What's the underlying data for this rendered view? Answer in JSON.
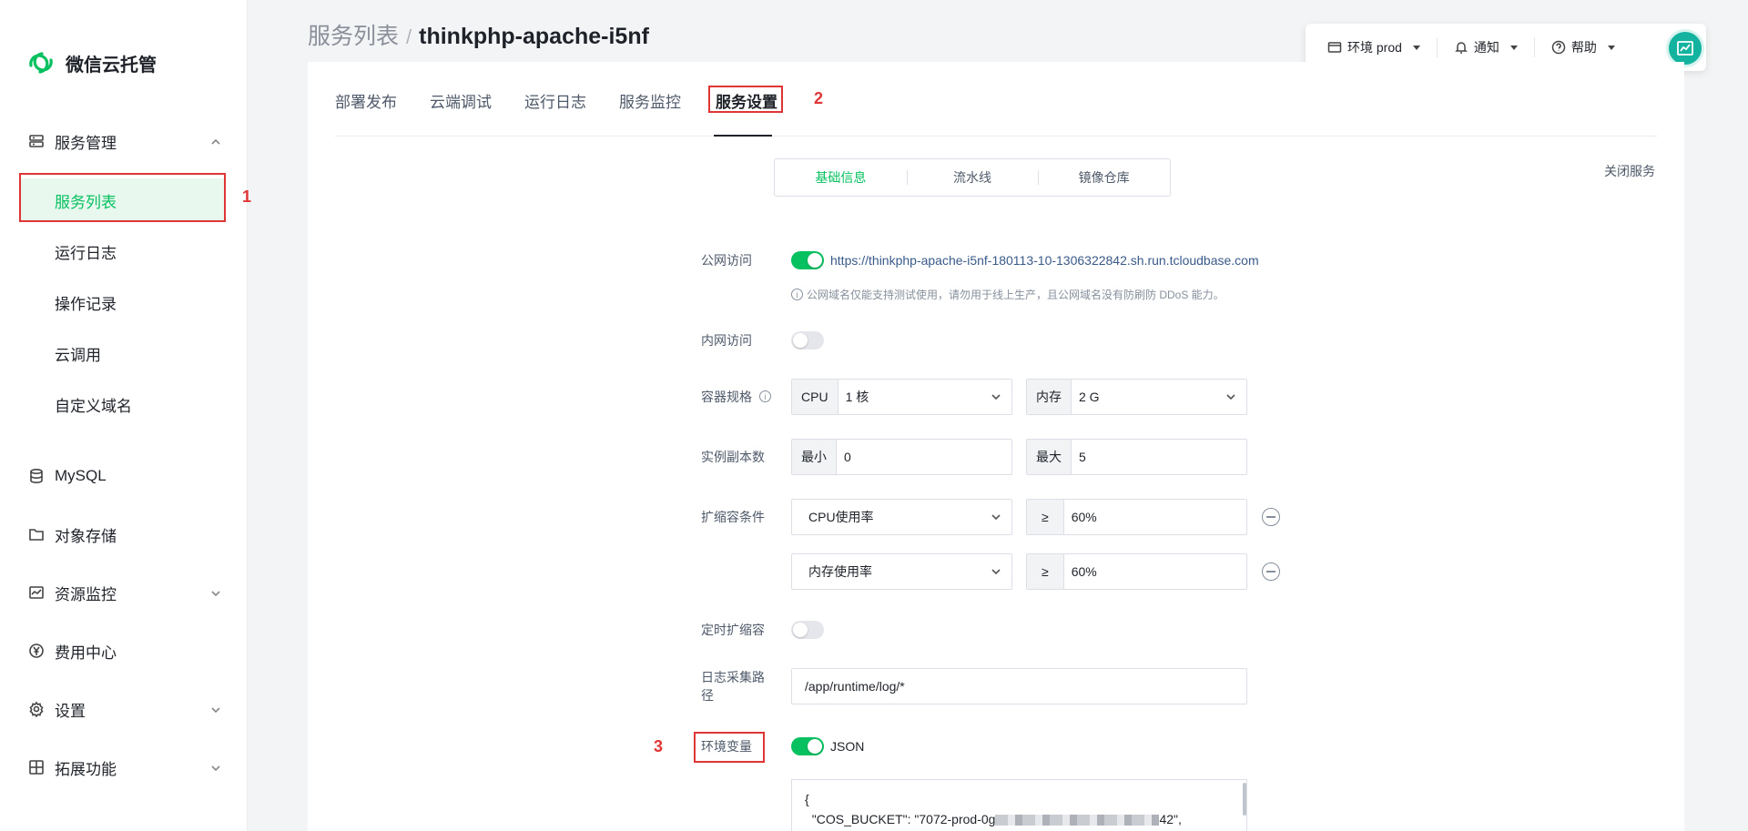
{
  "app": {
    "name": "微信云托管"
  },
  "sidebar": {
    "groups": [
      {
        "label": "服务管理",
        "icon": "server-icon",
        "expanded": true
      },
      {
        "label": "MySQL",
        "icon": "database-icon"
      },
      {
        "label": "对象存储",
        "icon": "folder-icon"
      },
      {
        "label": "资源监控",
        "icon": "monitor-icon",
        "expanded": false
      },
      {
        "label": "费用中心",
        "icon": "yen-icon"
      },
      {
        "label": "设置",
        "icon": "gear-icon",
        "expanded": false
      },
      {
        "label": "拓展功能",
        "icon": "extension-icon",
        "expanded": false
      }
    ],
    "items": [
      {
        "label": "服务列表",
        "active": true
      },
      {
        "label": "运行日志"
      },
      {
        "label": "操作记录"
      },
      {
        "label": "云调用"
      },
      {
        "label": "自定义域名"
      }
    ]
  },
  "annotations": {
    "n1": "1",
    "n2": "2",
    "n3": "3",
    "color": "#e03535"
  },
  "breadcrumb": {
    "parent": "服务列表",
    "separator": "/",
    "current": "thinkphp-apache-i5nf"
  },
  "topbar": {
    "env": "环境 prod",
    "notify": "通知",
    "help": "帮助"
  },
  "tabs": [
    {
      "label": "部署发布"
    },
    {
      "label": "云端调试"
    },
    {
      "label": "运行日志"
    },
    {
      "label": "服务监控"
    },
    {
      "label": "服务设置",
      "active": true
    }
  ],
  "segments": [
    {
      "label": "基础信息",
      "active": true
    },
    {
      "label": "流水线"
    },
    {
      "label": "镜像仓库"
    }
  ],
  "close_service": "关闭服务",
  "form": {
    "public_access": {
      "label": "公网访问",
      "enabled": true,
      "url": "https://thinkphp-apache-i5nf-180113-10-1306322842.sh.run.tcloudbase.com",
      "hint": "公网域名仅能支持测试使用，请勿用于线上生产，且公网域名没有防刷防 DDoS 能力。"
    },
    "private_access": {
      "label": "内网访问",
      "enabled": false
    },
    "spec": {
      "label": "容器规格",
      "cpu_prefix": "CPU",
      "cpu_value": "1 核",
      "mem_prefix": "内存",
      "mem_value": "2 G"
    },
    "replicas": {
      "label": "实例副本数",
      "min_prefix": "最小",
      "min_value": "0",
      "max_prefix": "最大",
      "max_value": "5"
    },
    "scaling": {
      "label": "扩缩容条件",
      "rules": [
        {
          "metric": "CPU使用率",
          "op": "≥",
          "value": "60%"
        },
        {
          "metric": "内存使用率",
          "op": "≥",
          "value": "60%"
        }
      ]
    },
    "timed_scaling": {
      "label": "定时扩缩容",
      "enabled": false
    },
    "log_path": {
      "label": "日志采集路径",
      "value": "/app/runtime/log/*"
    },
    "env_vars": {
      "label": "环境变量",
      "json_enabled": true,
      "json_label": "JSON",
      "code_line1": "{",
      "code_line2_prefix": "  \"COS_BUCKET\": \"7072-prod-0g",
      "code_line2_suffix": "42\","
    }
  },
  "colors": {
    "accent": "#07c160",
    "link": "#3a5a8a"
  }
}
